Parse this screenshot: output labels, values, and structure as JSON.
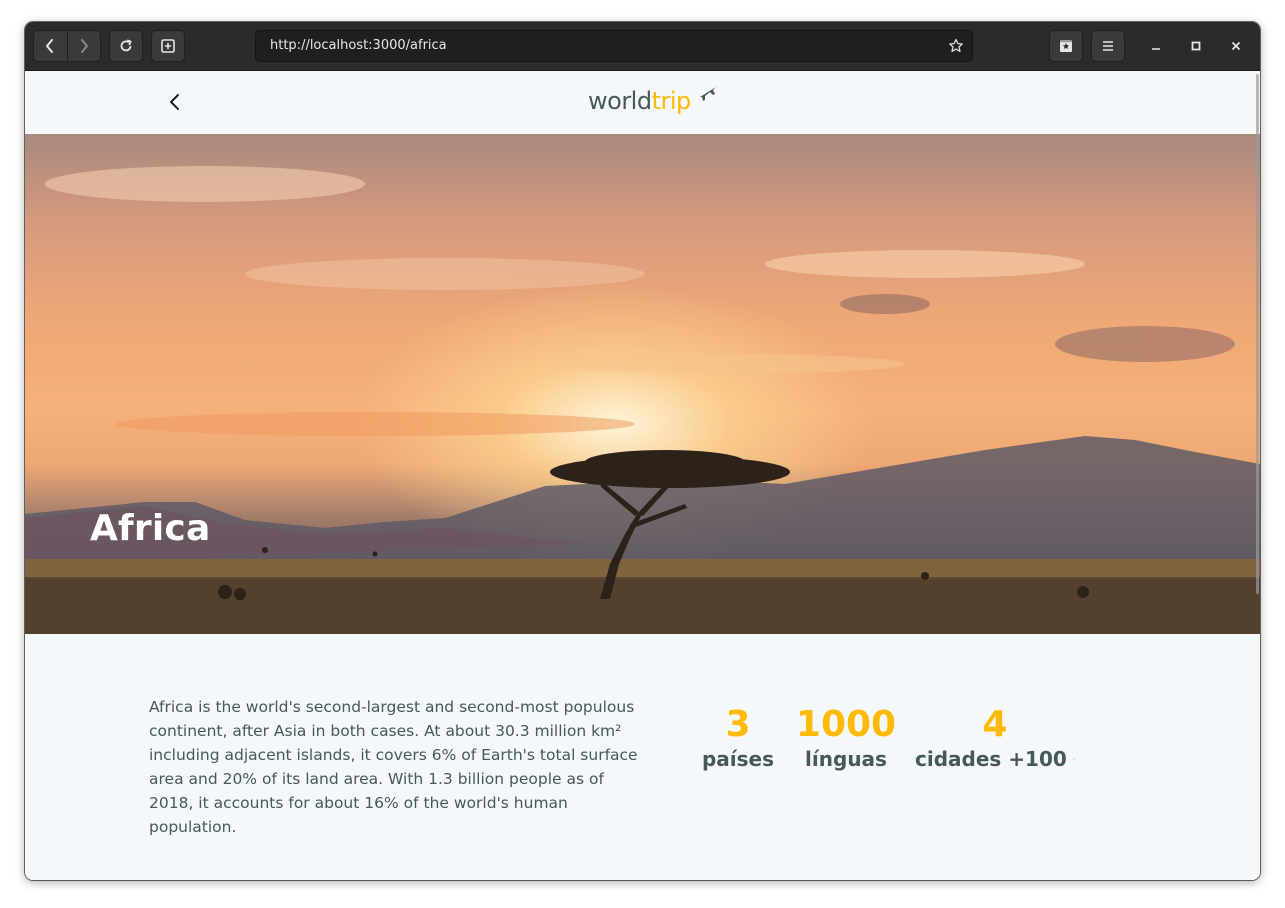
{
  "browser": {
    "url": "http://localhost:3000/africa"
  },
  "header": {
    "logo_prefix": "world",
    "logo_suffix": "trip"
  },
  "banner": {
    "title": "Africa"
  },
  "content": {
    "description": "Africa is the world's second-largest and second-most populous continent, after Asia in both cases. At about 30.3 million km² including adjacent islands, it covers 6% of Earth's total surface area and 20% of its land area. With 1.3 billion people as of 2018, it accounts for about 16% of the world's human population.",
    "stats": [
      {
        "value": "3",
        "label": "países"
      },
      {
        "value": "1000",
        "label": "línguas"
      },
      {
        "value": "4",
        "label": "cidades +100"
      }
    ]
  },
  "colors": {
    "highlight": "#ffba08",
    "text": "#47585b",
    "background": "#f5f8fa"
  }
}
